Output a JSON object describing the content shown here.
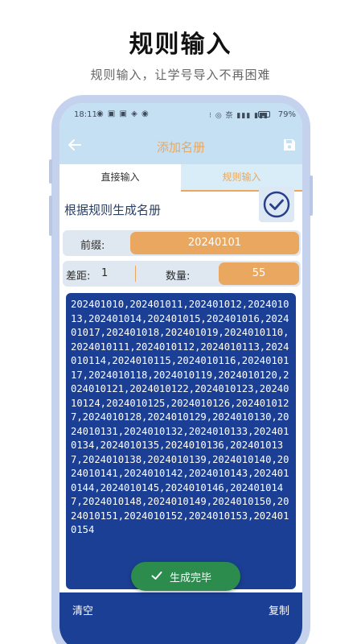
{
  "promo": {
    "title": "规则输入",
    "subtitle": "规则输入，让学号导入不再困难"
  },
  "status_bar": {
    "time": "18:11",
    "battery": "79%",
    "battery_level": 0.79,
    "left_icons": "◉ ▣ ▣ ◈ ◉",
    "right_icons": "⁝ ◎ 奈 ▮▮▮ ▮▮▮"
  },
  "app_bar": {
    "title": "添加名册",
    "back_icon": "arrow-left-icon",
    "save_icon": "save-icon"
  },
  "tabs": [
    {
      "label": "直接输入",
      "active": false
    },
    {
      "label": "规则输入",
      "active": true
    }
  ],
  "section": {
    "label": "根据规则生成名册",
    "confirm_icon": "check-circle-icon"
  },
  "prefix": {
    "label": "前缀:",
    "value": "20240101"
  },
  "gap": {
    "label": "差距:",
    "value": "1"
  },
  "count": {
    "label": "数量:",
    "value": "55"
  },
  "output": {
    "text": "202401010,202401011,202401012,202401013,202401014,202401015,202401016,202401017,202401018,202401019,2024010110,2024010111,2024010112,2024010113,2024010114,2024010115,2024010116,2024010117,2024010118,2024010119,2024010120,2024010121,2024010122,2024010123,2024010124,2024010125,2024010126,2024010127,2024010128,2024010129,2024010130,2024010131,2024010132,2024010133,2024010134,2024010135,2024010136,2024010137,2024010138,2024010139,2024010140,2024010141,2024010142,2024010143,2024010144,2024010145,2024010146,2024010147,2024010148,2024010149,2024010150,2024010151,2024010152,2024010153,2024010154"
  },
  "bottom_bar": {
    "clear_label": "清空",
    "copy_label": "复制"
  },
  "toast": {
    "label": "生成完毕",
    "icon": "check-icon"
  },
  "colors": {
    "accent_orange": "#e9a760",
    "header_blue": "#c6e0f3",
    "output_navy": "#1b3f94",
    "toast_green": "#2c8c4e"
  }
}
